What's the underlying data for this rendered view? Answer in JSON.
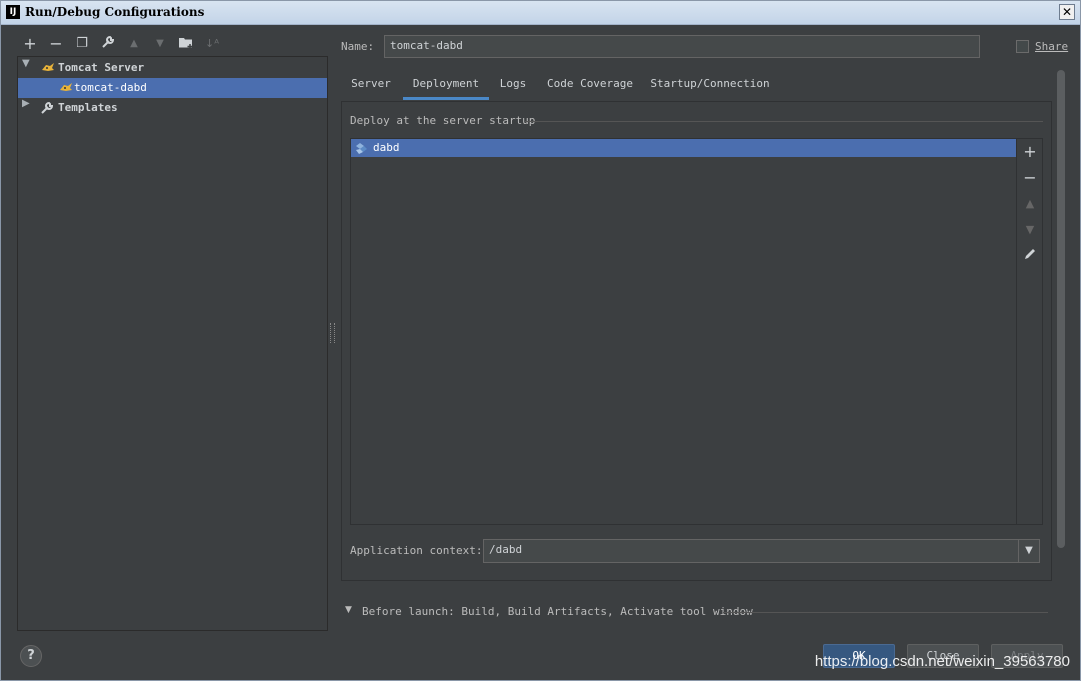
{
  "window": {
    "title": "Run/Debug Configurations",
    "app_icon": "IJ"
  },
  "toolbar": {
    "icons": [
      "add-icon",
      "remove-icon",
      "copy-icon",
      "wrench-icon",
      "move-up-icon",
      "move-down-icon",
      "folder-add-icon",
      "sort-icon"
    ]
  },
  "tree": {
    "group_label": "Tomcat Server",
    "config_label": "tomcat-dabd",
    "templates_label": "Templates"
  },
  "name_field": {
    "label": "Name:",
    "value": "tomcat-dabd"
  },
  "share": {
    "label": "Share",
    "checked": false
  },
  "tabs": [
    {
      "label": "Server",
      "active": false
    },
    {
      "label": "Deployment",
      "active": true
    },
    {
      "label": "Logs",
      "active": false
    },
    {
      "label": "Code Coverage",
      "active": false
    },
    {
      "label": "Startup/Connection",
      "active": false
    }
  ],
  "deployment": {
    "section_title": "Deploy at the server startup",
    "items": [
      "dabd"
    ],
    "context_label": "Application context:",
    "context_value": "/dabd"
  },
  "before_launch": {
    "label": "Before launch: Build, Build Artifacts, Activate tool window"
  },
  "buttons": {
    "ok": "OK",
    "close": "Close",
    "apply": "Apply"
  },
  "watermark": "https://blog.csdn.net/weixin_39563780",
  "colors": {
    "selection": "#4b6eaf",
    "background": "#3c3f41",
    "primary_button": "#365880",
    "tab_underline": "#4a88c7"
  }
}
